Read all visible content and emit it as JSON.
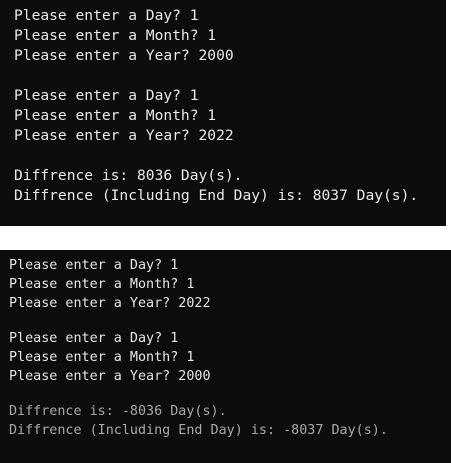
{
  "top_console": {
    "lines": [
      "Please enter a Day? 1",
      "Please enter a Month? 1",
      "Please enter a Year? 2000",
      "Please enter a Day? 1",
      "Please enter a Month? 1",
      "Please enter a Year? 2022",
      "Diffrence is: 8036 Day(s).",
      "Diffrence (Including End Day) is: 8037 Day(s)."
    ]
  },
  "bottom_console": {
    "lines": [
      "Please enter a Day? 1",
      "Please enter a Month? 1",
      "Please enter a Year? 2022",
      "Please enter a Day? 1",
      "Please enter a Month? 1",
      "Please enter a Year? 2000",
      "Diffrence is: -8036 Day(s).",
      "Diffrence (Including End Day) is: -8037 Day(s)."
    ]
  },
  "colors": {
    "console_background": "#0c0c0c",
    "text": "#eaeaea",
    "dim_text": "#a9a9a9",
    "page_background": "#ffffff"
  }
}
